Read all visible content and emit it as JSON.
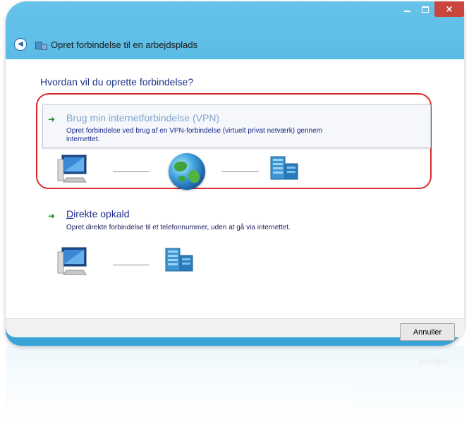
{
  "window": {
    "title": "Opret forbindelse til en arbejdsplads",
    "close_glyph": "×"
  },
  "question": "Hvordan vil du oprette forbindelse?",
  "options": [
    {
      "title": "Brug min internetforbindelse (VPN)",
      "description_line1": "Opret forbindelse ved brug af en VPN-forbindelse (virtuelt privat netværk) gennem",
      "description_line2": "internettet.",
      "icons": [
        "computer-icon",
        "globe-icon",
        "server-icon"
      ]
    },
    {
      "title_accesskey": "D",
      "title_rest": "irekte opkald",
      "description": "Opret direkte forbindelse til et telefonnummer, uden at gå via internettet.",
      "icons": [
        "computer-icon",
        "server-icon"
      ]
    }
  ],
  "footer": {
    "cancel_label": "Annuller"
  },
  "reflection_text": "Annuller",
  "colors": {
    "frame": "#4fb2df",
    "highlight_ring": "#d9292b",
    "heading": "#1e3287",
    "option_title_vpn": "#7ea3cf",
    "option_title": "#1b2a8d",
    "arrow": "#1d8a27",
    "close_button": "#c9463d"
  }
}
